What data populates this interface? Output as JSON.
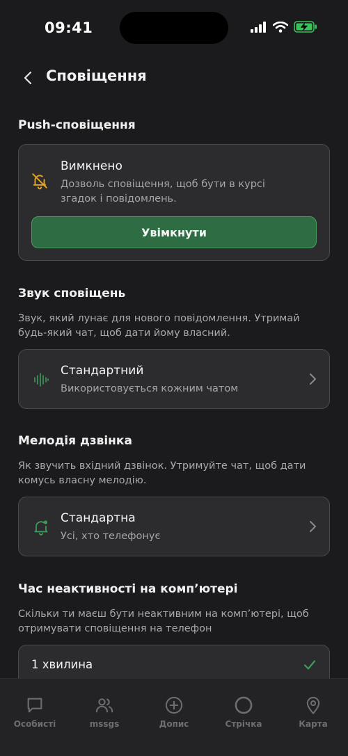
{
  "status_bar": {
    "time": "09:41"
  },
  "header": {
    "title": "Сповіщення"
  },
  "push": {
    "section_title": "Push-сповіщення",
    "status_title": "Вимкнено",
    "status_desc_line1": "Дозволь сповіщення, щоб бути в курсі",
    "status_desc_line2": "згадок і повідомлень.",
    "enable_label": "Увімкнути"
  },
  "sound": {
    "section_title": "Звук сповіщень",
    "desc_line1": "Звук, який лунає для нового повідомлення. Утримай",
    "desc_line2": "будь-який чат, щоб дати йому власний.",
    "item_title": "Стандартний",
    "item_sub": "Використовується кожним чатом"
  },
  "ringtone": {
    "section_title": "Мелодія дзвінка",
    "desc_line1": "Як звучить вхідний дзвінок. Утримуйте чат, щоб дати",
    "desc_line2": "комусь власну мелодію.",
    "item_title": "Стандартна",
    "item_sub": "Усі, хто телефонує"
  },
  "inactivity": {
    "section_title": "Час неактивності на комп’ютері",
    "desc_line1": "Скільки ти маєш бути неактивним на комп’ютері, щоб",
    "desc_line2": "отримувати сповіщення на телефон",
    "option_label": "1 хвилина"
  },
  "tabbar": {
    "tabs": [
      {
        "label": "Особисті",
        "icon": "chat-bubble-icon"
      },
      {
        "label": "mssgs",
        "icon": "people-icon"
      },
      {
        "label": "Допис",
        "icon": "plus-circle-icon"
      },
      {
        "label": "Стрічка",
        "icon": "circle-icon"
      },
      {
        "label": "Карта",
        "icon": "map-pin-icon"
      }
    ]
  },
  "colors": {
    "background": "#1b1b1d",
    "card": "#2c2c2e",
    "accent_green": "#2e6c43",
    "warning_yellow": "#e0a22a",
    "icon_green": "#3f9a5e"
  }
}
